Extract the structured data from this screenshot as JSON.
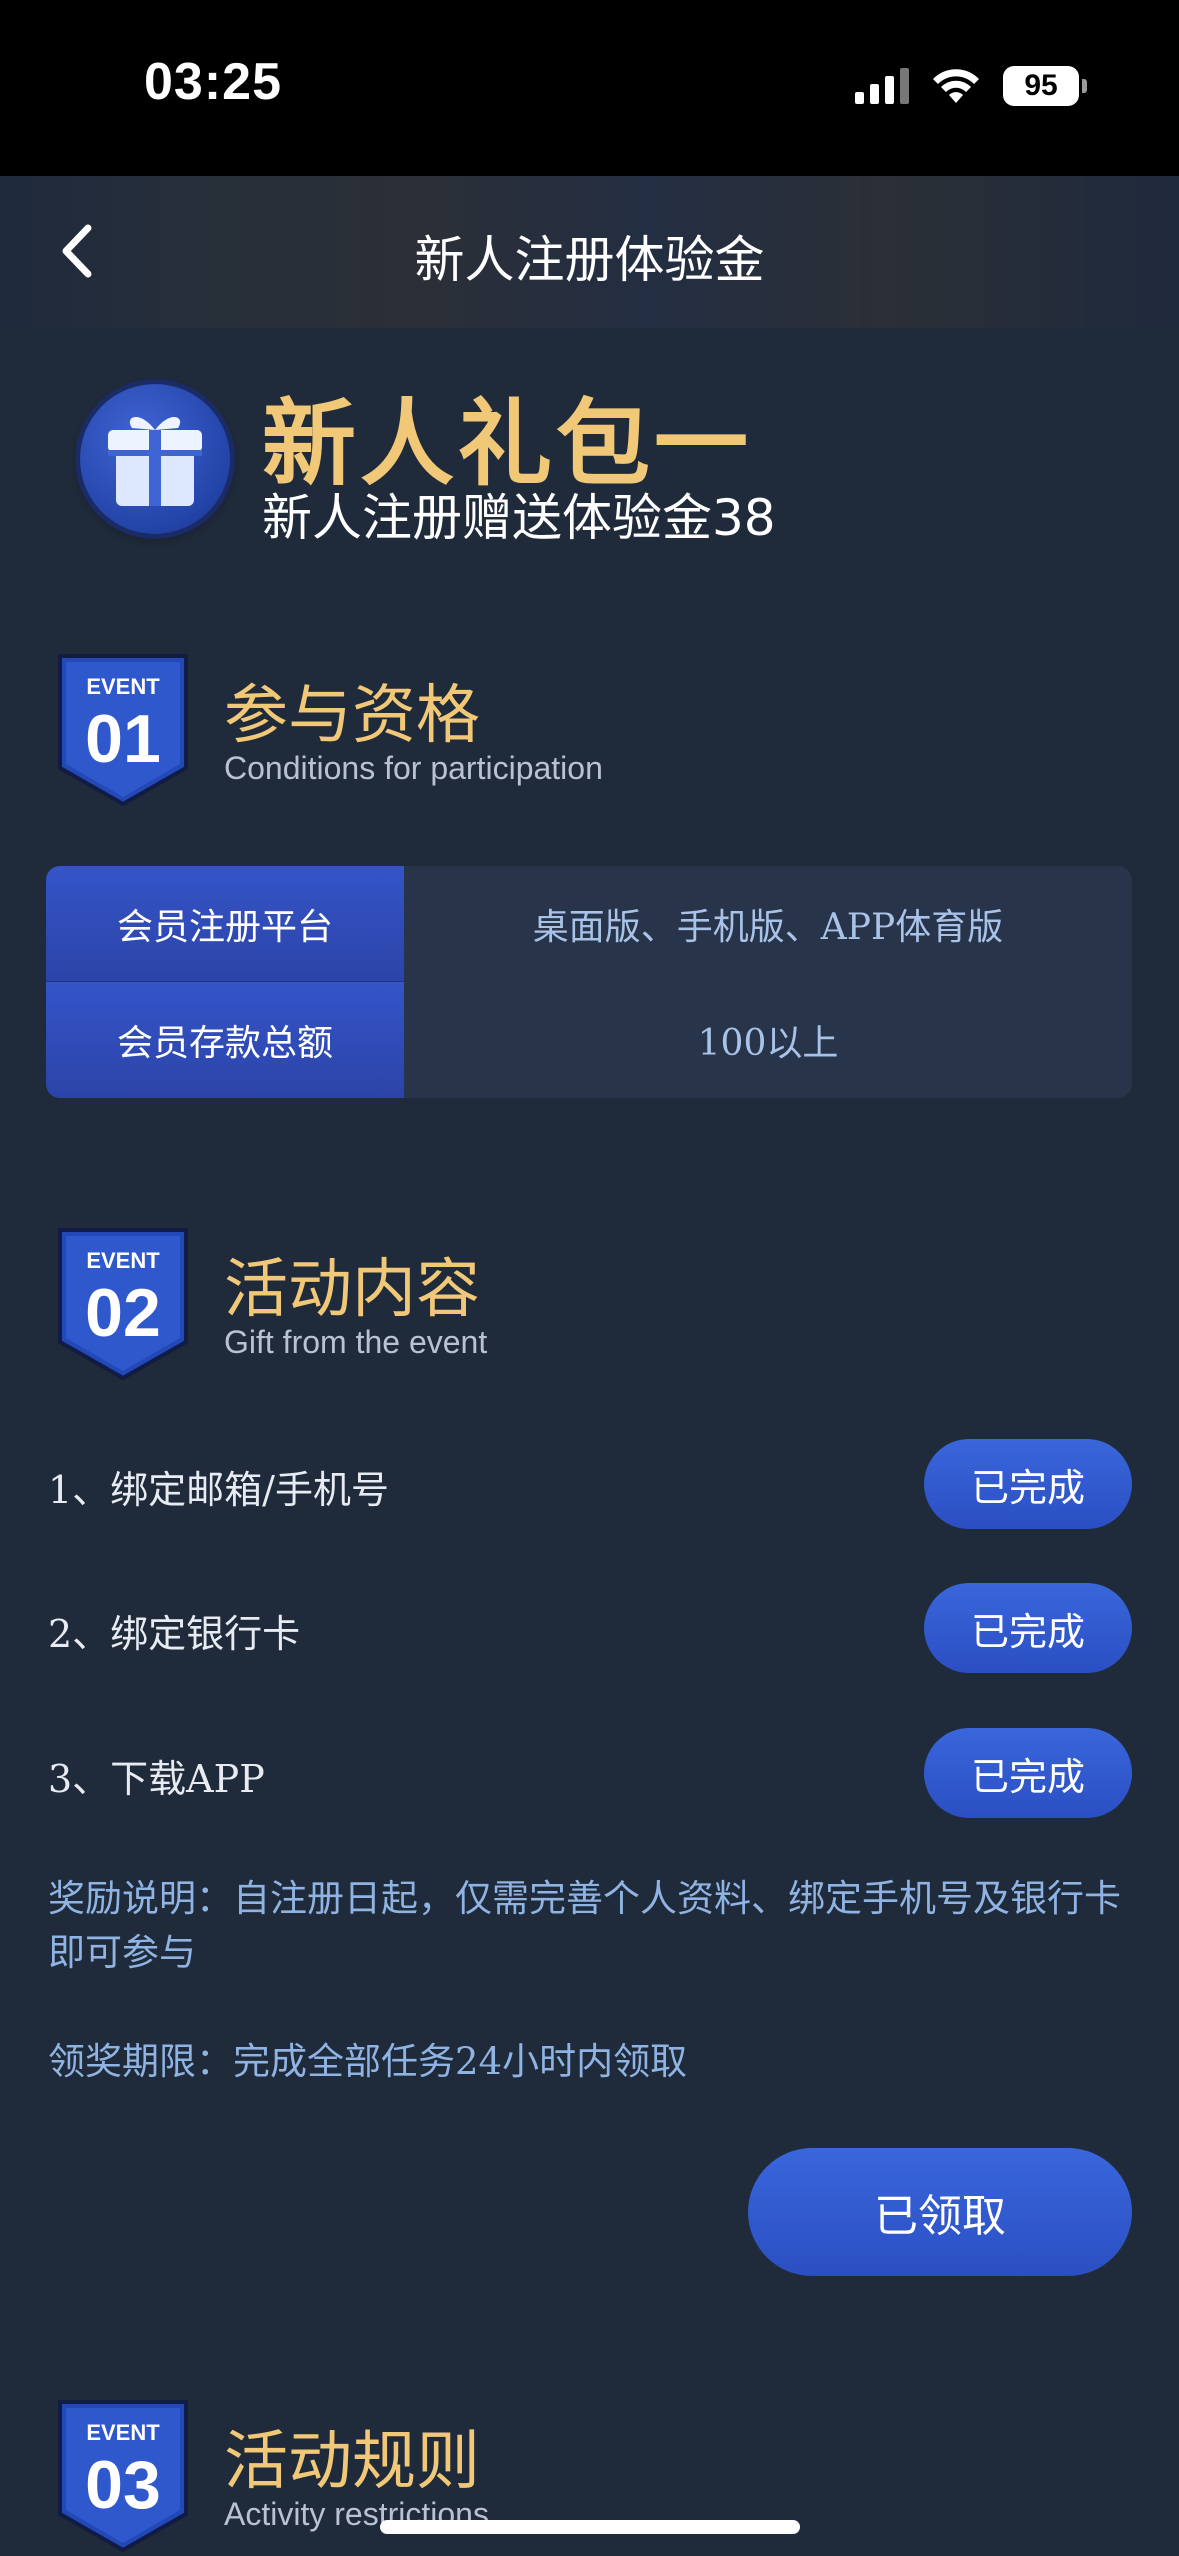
{
  "status_bar": {
    "time": "03:25",
    "battery": "95",
    "icons": [
      "signal-icon",
      "wifi-icon",
      "battery-icon"
    ]
  },
  "nav": {
    "title": "新人注册体验金",
    "back_icon": "chevron-left-icon"
  },
  "hero": {
    "icon": "gift-icon",
    "title": "新人礼包一",
    "subtitle": "新人注册赠送体验金38"
  },
  "sections": [
    {
      "badge_top": "EVENT",
      "badge_num": "01",
      "title": "参与资格",
      "subtitle": "Conditions for participation"
    },
    {
      "badge_top": "EVENT",
      "badge_num": "02",
      "title": "活动内容",
      "subtitle": "Gift from the event"
    },
    {
      "badge_top": "EVENT",
      "badge_num": "03",
      "title": "活动规则",
      "subtitle": "Activity restrictions"
    }
  ],
  "conditions": [
    {
      "label": "会员注册平台",
      "value": "桌面版、手机版、APP体育版"
    },
    {
      "label": "会员存款总额",
      "value": "100以上"
    }
  ],
  "tasks": [
    {
      "label": "1、绑定邮箱/手机号",
      "status": "已完成"
    },
    {
      "label": "2、绑定银行卡",
      "status": "已完成"
    },
    {
      "label": "3、下载APP",
      "status": "已完成"
    }
  ],
  "notes": {
    "reward": "奖励说明：自注册日起，仅需完善个人资料、绑定手机号及银行卡即可参与",
    "deadline": "领奖期限：完成全部任务24小时内领取"
  },
  "claim_button": "已领取",
  "colors": {
    "background": "#1f2a3a",
    "accent_gold": "#f0c878",
    "button_blue": "#2f58cc",
    "note_blue": "#8fb3e2"
  }
}
